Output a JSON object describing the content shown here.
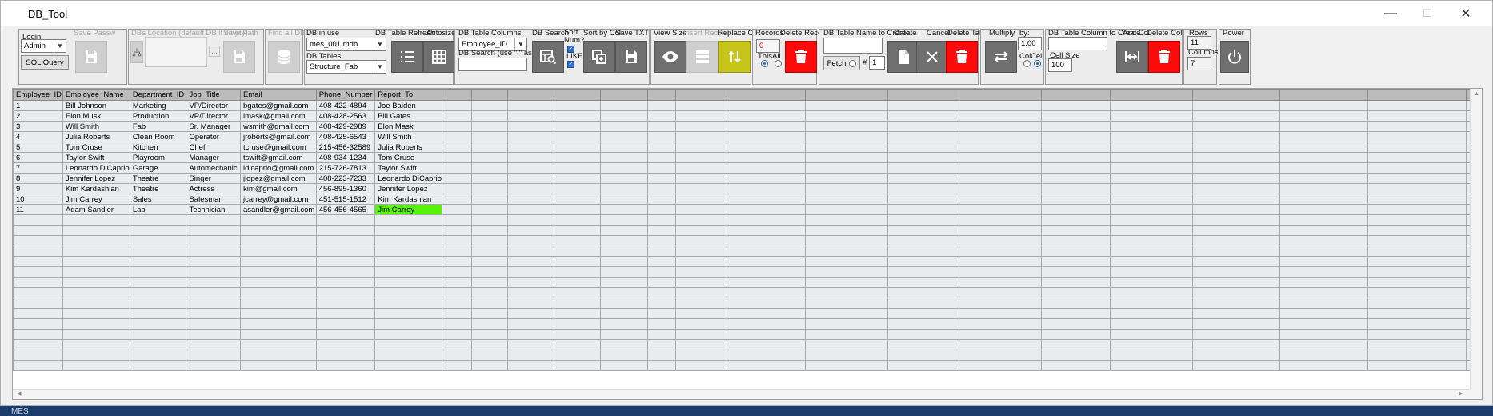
{
  "window": {
    "title": "DB_Tool",
    "minimize": "—",
    "maximize": "☐",
    "close": "✕"
  },
  "taskbar": {
    "text": "MES"
  },
  "login": {
    "label": "Login",
    "user": "Admin",
    "sql_query": "SQL Query",
    "save_passw": "Save Passw"
  },
  "db_location": {
    "label": "DBs Location (default DB if empty)",
    "value": "",
    "browse": "...",
    "save_path": "Save Path"
  },
  "find_all": {
    "label": "Find all DBs"
  },
  "db_in_use": {
    "label": "DB in use",
    "value": "mes_001.mdb",
    "tables_label": "DB Tables",
    "tables_value": "Structure_Fab",
    "refresh": "DB Table Refresh",
    "autosize": "Autosize"
  },
  "columns": {
    "label": "DB Table Columns",
    "value": "Employee_ID",
    "search_label": "DB Search (use \";\" as delim)",
    "search_value": "",
    "db_search": "DB Search",
    "sort_num": "Sort\nNum?",
    "like": "LIKE",
    "sort_by_col": "Sort by Col",
    "save_txt": "Save TXT"
  },
  "view": {
    "view_size": "View Size",
    "insert_record": "Insert Record",
    "replace_cell": "Replace Cell"
  },
  "records": {
    "label": "Records",
    "delete_record": "Delete Record",
    "count": "0",
    "this": "This",
    "all": "All"
  },
  "table_create": {
    "label": "DB Table Name to Create",
    "value": "",
    "create": "Create",
    "cancel": "Cancel",
    "delete_table": "Delete Table",
    "fetch": "Fetch",
    "hash": "#",
    "fetch_count": "1"
  },
  "multiply": {
    "label": "Multiply",
    "by_label": "by:",
    "by_value": "1.00",
    "col": "Col",
    "cell": "Cell"
  },
  "column_create": {
    "label": "DB Table Column to Create",
    "value": "",
    "add_col": "Add Col",
    "delete_col": "Delete Col",
    "cell_size_label": "Cell Size",
    "cell_size": "100"
  },
  "counts": {
    "rows_label": "Rows",
    "rows": "11",
    "columns_label": "Columns",
    "columns": "7"
  },
  "power": {
    "label": "Power"
  },
  "grid": {
    "headers": [
      "Employee_ID",
      "Employee_Name",
      "Department_ID",
      "Job_Title",
      "Email",
      "Phone_Number",
      "Report_To"
    ],
    "rows": [
      [
        "1",
        "Bill Johnson",
        "Marketing",
        "VP/Director",
        "bgates@gmail.com",
        "408-422-4894",
        "Joe Baiden"
      ],
      [
        "2",
        "Elon Musk",
        "Production",
        "VP/Director",
        "lmask@gmail.com",
        "408-428-2563",
        "Bill Gates"
      ],
      [
        "3",
        "Will Smith",
        "Fab",
        "Sr. Manager",
        "wsmith@gmail.com",
        "408-429-2989",
        "Elon Mask"
      ],
      [
        "4",
        "Julia Roberts",
        "Clean Room",
        "Operator",
        "jroberts@gmail.com",
        "408-425-6543",
        "Will Smith"
      ],
      [
        "5",
        "Tom Cruse",
        "Kitchen",
        "Chef",
        "tcruse@gmail.com",
        "215-456-32589",
        "Julia Roberts"
      ],
      [
        "6",
        "Taylor Swift",
        "Playroom",
        "Manager",
        "tswift@gmail.com",
        "408-934-1234",
        "Tom Cruse"
      ],
      [
        "7",
        "Leonardo DiCaprio",
        "Garage",
        "Automechanic",
        "ldicaprio@gmail.com",
        "215-726-7813",
        "Taylor Swift"
      ],
      [
        "8",
        "Jennifer Lopez",
        "Theatre",
        "Singer",
        "jlopez@gmail.com",
        "408-223-7233",
        "Leonardo DiCaprio"
      ],
      [
        "9",
        "Kim Kardashian",
        "Theatre",
        "Actress",
        "kim@gmail.com",
        "456-895-1360",
        "Jennifer Lopez"
      ],
      [
        "10",
        "Jim Carrey",
        "Sales",
        "Salesman",
        "jcarrey@gmail.com",
        "451-515-1512",
        "Kim Kardashian"
      ],
      [
        "11",
        "Adam Sandler",
        "Lab",
        "Technician",
        "asandler@gmail.com",
        "456-456-4565",
        "Jim Carrey"
      ]
    ],
    "highlight_color": "#58f20a"
  },
  "colors": {
    "accent_red": "#ff0a0a",
    "accent_yellow": "#c7c41a",
    "button_gray": "#6f6f6f",
    "taskbar_blue": "#1c3d6b"
  }
}
